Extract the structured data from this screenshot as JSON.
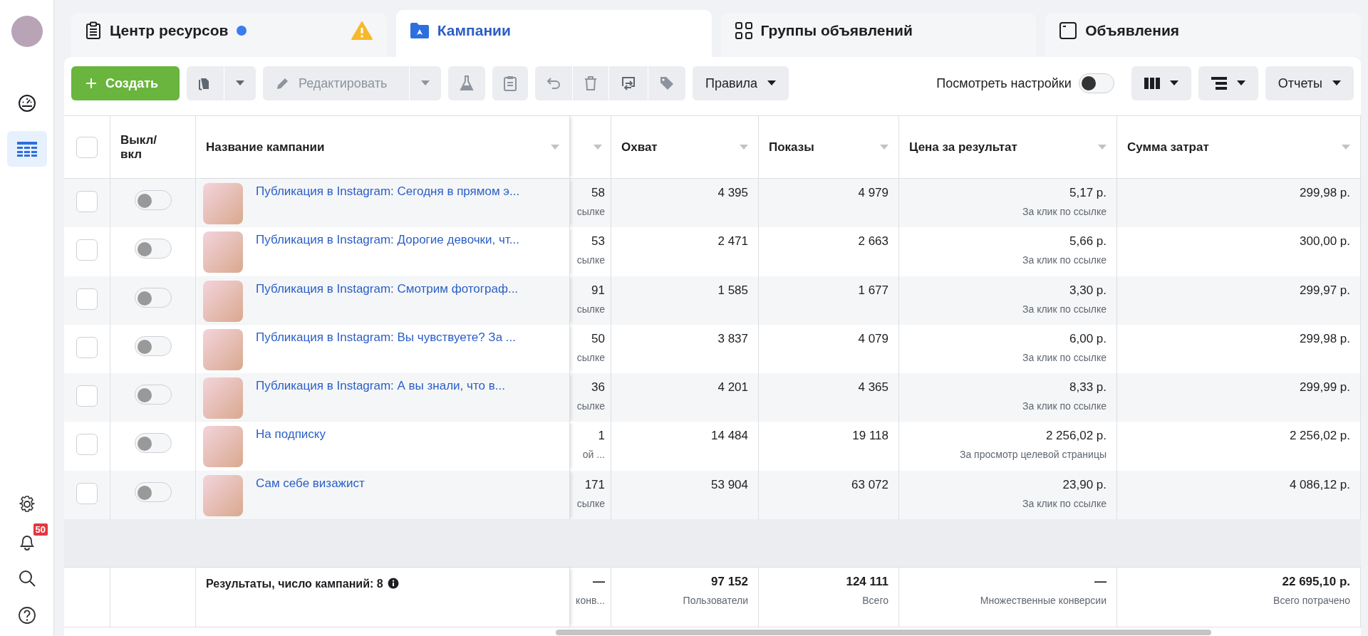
{
  "sidebar": {
    "notifications_badge": "50",
    "items": [
      {
        "kind": "gauge",
        "selected": false
      },
      {
        "kind": "table",
        "selected": true
      }
    ]
  },
  "tabs": [
    {
      "label": "Центр ресурсов",
      "kind": "resources",
      "selected": false,
      "status_dot": true,
      "warning": true
    },
    {
      "label": "Кампании",
      "kind": "campaigns",
      "selected": true,
      "status_dot": false,
      "warning": false
    },
    {
      "label": "Группы объявлений",
      "kind": "adsets",
      "selected": false,
      "status_dot": false,
      "warning": false
    },
    {
      "label": "Объявления",
      "kind": "ads",
      "selected": false,
      "status_dot": false,
      "warning": false
    }
  ],
  "toolbar": {
    "create": "Создать",
    "edit": {
      "label": "Редактировать",
      "disabled": true
    },
    "rules": "Правила",
    "view_settings": {
      "label": "Посмотреть настройки",
      "on": false
    },
    "reports": "Отчеты"
  },
  "table": {
    "select_all_checked": false,
    "columns": [
      {
        "label": "Выкл/ вкл"
      },
      {
        "label": "Название кампании"
      },
      {
        "label": "Охват"
      },
      {
        "label": "Показы"
      },
      {
        "label": "Цена за результат"
      },
      {
        "label": "Сумма затрат"
      }
    ],
    "rows": [
      {
        "checked": false,
        "on": false,
        "name": "Публикация в Instagram: Сегодня в прямом э...",
        "column_4": "58",
        "column_4_note": "сылке",
        "reach": "4 395",
        "impressions": "4 979",
        "cost": "5,17 р.",
        "cost_note": "За клик по ссылке",
        "spent": "299,98 р."
      },
      {
        "checked": false,
        "on": false,
        "name": "Публикация в Instagram: Дорогие девочки, чт...",
        "column_4": "53",
        "column_4_note": "сылке",
        "reach": "2 471",
        "impressions": "2 663",
        "cost": "5,66 р.",
        "cost_note": "За клик по ссылке",
        "spent": "300,00 р."
      },
      {
        "checked": false,
        "on": false,
        "name": "Публикация в Instagram: Смотрим фотограф...",
        "column_4": "91",
        "column_4_note": "сылке",
        "reach": "1 585",
        "impressions": "1 677",
        "cost": "3,30 р.",
        "cost_note": "За клик по ссылке",
        "spent": "299,97 р."
      },
      {
        "checked": false,
        "on": false,
        "name": "Публикация в Instagram: Вы чувствуете? За ...",
        "column_4": "50",
        "column_4_note": "сылке",
        "reach": "3 837",
        "impressions": "4 079",
        "cost": "6,00 р.",
        "cost_note": "За клик по ссылке",
        "spent": "299,98 р."
      },
      {
        "checked": false,
        "on": false,
        "name": "Публикация в Instagram: А вы знали, что в...",
        "column_4": "36",
        "column_4_note": "сылке",
        "reach": "4 201",
        "impressions": "4 365",
        "cost": "8,33 р.",
        "cost_note": "За клик по ссылке",
        "spent": "299,99 р."
      },
      {
        "checked": false,
        "on": false,
        "name": "На подписку",
        "column_4": "1",
        "column_4_note": "ой ...",
        "reach": "14 484",
        "impressions": "19 118",
        "cost": "2 256,02 р.",
        "cost_note": "За просмотр целевой страницы",
        "spent": "2 256,02 р."
      },
      {
        "checked": false,
        "on": false,
        "name": "Сам себе визажист",
        "column_4": "171",
        "column_4_note": "сылке",
        "reach": "53 904",
        "impressions": "63 072",
        "cost": "23,90 р.",
        "cost_note": "За клик по ссылке",
        "spent": "4 086,12 р."
      }
    ],
    "footer": {
      "label": "Результаты, число кампаний: 8",
      "column_4": "—",
      "column_4_note": "конв...",
      "reach": "97 152",
      "reach_note": "Пользователи",
      "impressions": "124 111",
      "impressions_note": "Всего",
      "cost": "—",
      "cost_note": "Множественные конверсии",
      "spent": "22 695,10 р.",
      "spent_note": "Всего потрачено"
    }
  }
}
